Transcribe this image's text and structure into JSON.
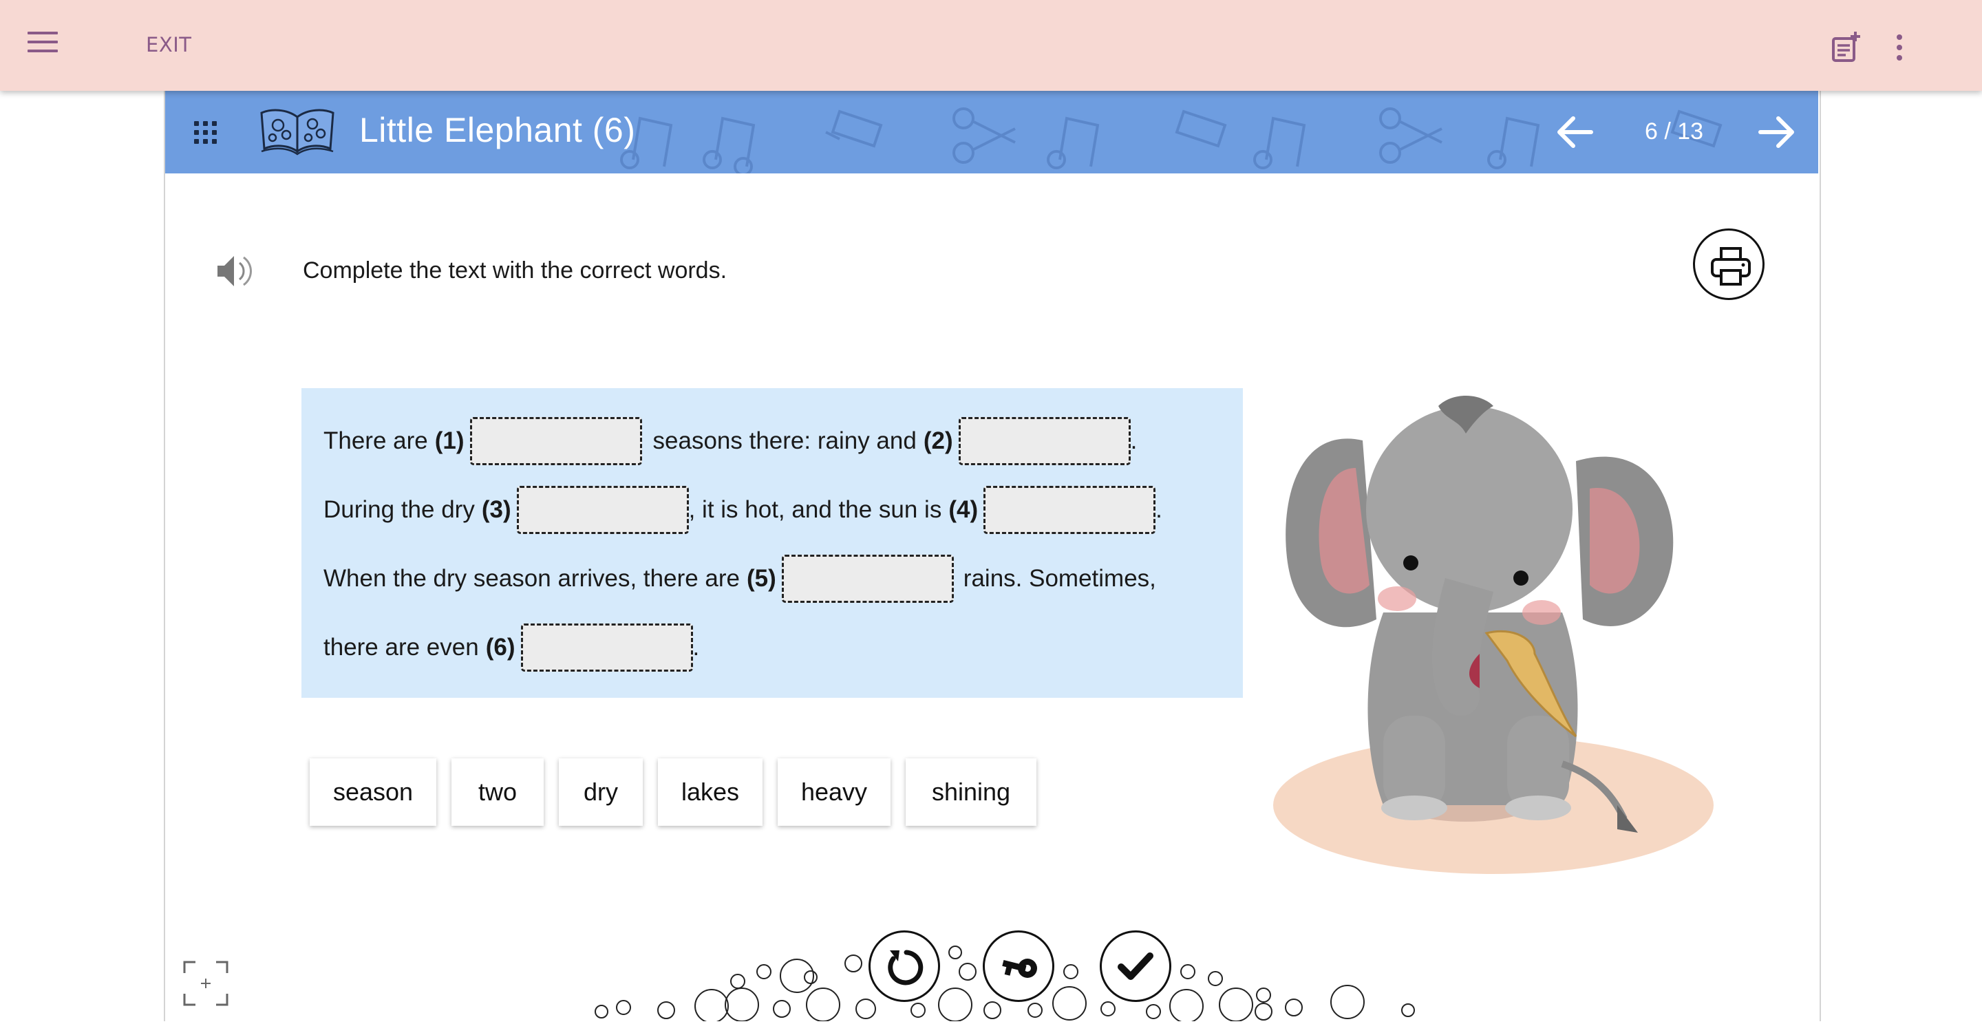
{
  "appbar": {
    "exit_label": "EXIT"
  },
  "header": {
    "title": "Little Elephant (6)",
    "page_indicator": "6 / 13"
  },
  "instruction": "Complete the text with the correct words.",
  "exercise": {
    "line1": {
      "a": "There are",
      "n1": "(1)",
      "b": "seasons there: rainy and",
      "n2": "(2)",
      "c": "."
    },
    "line2": {
      "a": "During the dry",
      "n3": "(3)",
      "b": ", it is hot, and the sun is",
      "n4": "(4)",
      "c": "."
    },
    "line3": {
      "a": "When the dry season arrives, there are",
      "n5": "(5)",
      "b": "rains. Sometimes,"
    },
    "line4": {
      "a": "there are even",
      "n6": "(6)",
      "c": "."
    }
  },
  "word_bank": [
    "season",
    "two",
    "dry",
    "lakes",
    "heavy",
    "shining"
  ],
  "colors": {
    "appbar": "#f7d9d3",
    "appbar_text": "#8a5a88",
    "titlebar": "#6e9de0",
    "text_panel": "#d6eafb",
    "blank_fill": "#ececec"
  },
  "icons": [
    "menu-icon",
    "add-note-icon",
    "more-vert-icon",
    "apps-grid-icon",
    "book-icon",
    "arrow-left-icon",
    "arrow-right-icon",
    "speaker-icon",
    "printer-icon",
    "fullscreen-icon",
    "reset-icon",
    "key-icon",
    "check-icon"
  ]
}
